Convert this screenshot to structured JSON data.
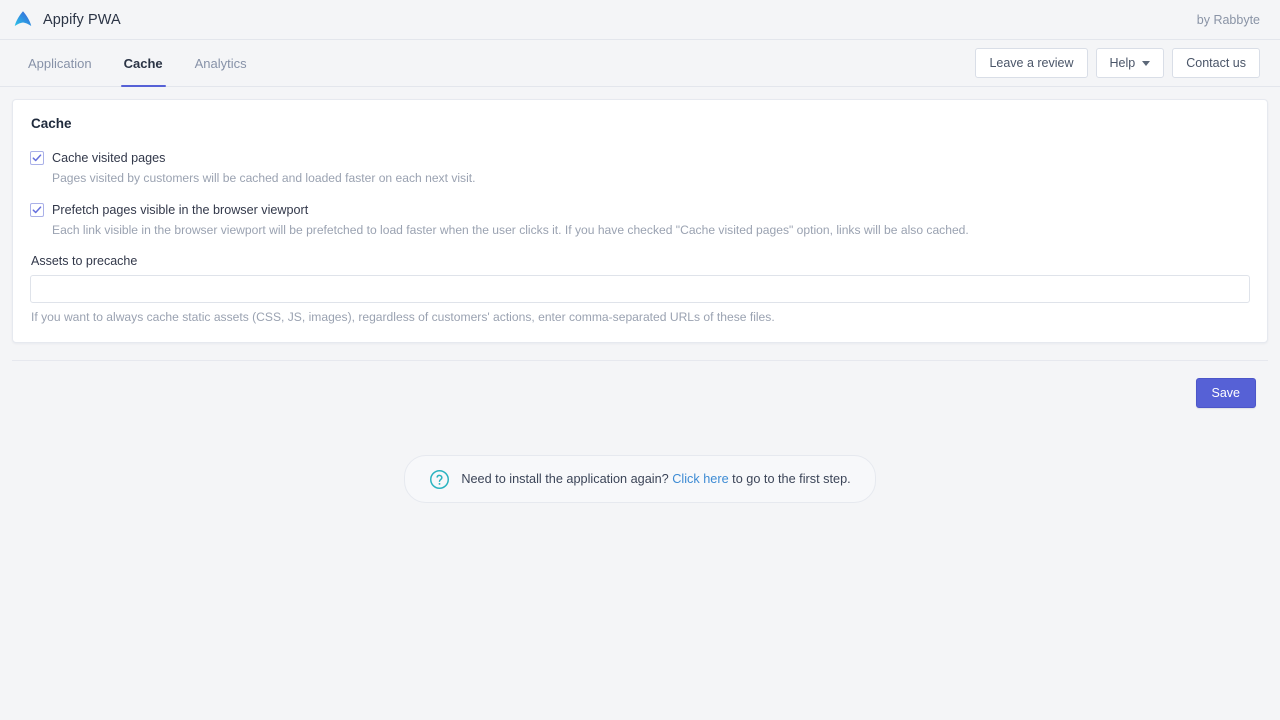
{
  "header": {
    "logo_icon": "appify-arrow-logo",
    "app_title": "Appify PWA",
    "byline": "by Rabbyte"
  },
  "tabs": [
    {
      "label": "Application",
      "active": false
    },
    {
      "label": "Cache",
      "active": true
    },
    {
      "label": "Analytics",
      "active": false
    }
  ],
  "toolbar": {
    "review_label": "Leave a review",
    "help_label": "Help",
    "help_caret_icon": "chevron-down-icon",
    "contact_label": "Contact us"
  },
  "card": {
    "title": "Cache",
    "options": [
      {
        "label": "Cache visited pages",
        "checked": true,
        "description": "Pages visited by customers will be cached and loaded faster on each next visit."
      },
      {
        "label": "Prefetch pages visible in the browser viewport",
        "checked": true,
        "description": "Each link visible in the browser viewport will be prefetched to load faster when the user clicks it. If you have checked \"Cache visited pages\" option, links will be also cached."
      }
    ],
    "assets_field": {
      "label": "Assets to precache",
      "value": "",
      "placeholder": "",
      "help": "If you want to always cache static assets (CSS, JS, images), regardless of customers' actions, enter comma-separated URLs of these files."
    }
  },
  "footer": {
    "save_label": "Save"
  },
  "notice": {
    "icon": "question-circle-icon",
    "text_before": "Need to install the application again?",
    "link_text": "Click here",
    "text_after": "to go to the first step."
  },
  "colors": {
    "accent": "#5661d6",
    "link": "#3d8bd4",
    "notice_icon": "#2bb3c0",
    "page_bg": "#f4f5f7",
    "checkbox_border": "#aab1e8"
  }
}
